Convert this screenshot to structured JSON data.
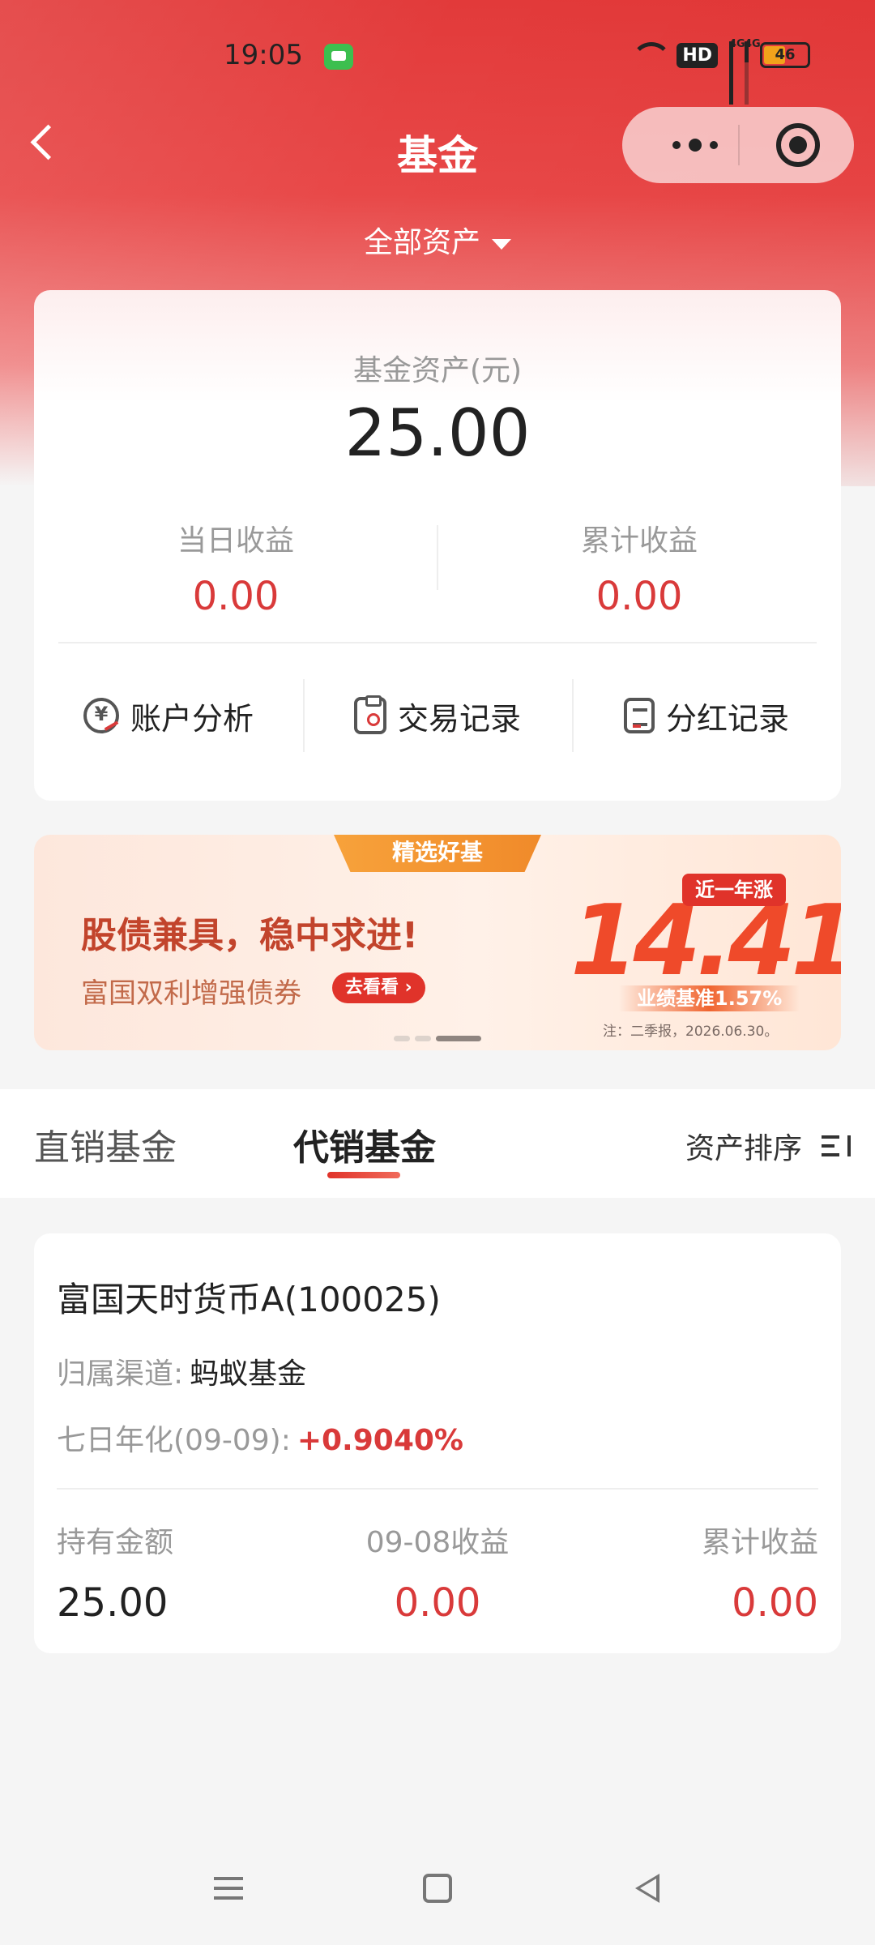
{
  "status_bar": {
    "time": "19:05",
    "hd_label": "HD",
    "net1": "4G",
    "net2": "4G",
    "battery": "46"
  },
  "nav": {
    "title": "基金",
    "asset_filter": "全部资产"
  },
  "asset_card": {
    "label": "基金资产(元)",
    "total": "25.00",
    "daily_label": "当日收益",
    "daily_value": "0.00",
    "cumulative_label": "累计收益",
    "cumulative_value": "0.00",
    "actions": [
      {
        "label": "账户分析",
        "icon": "account-analysis-icon"
      },
      {
        "label": "交易记录",
        "icon": "transaction-record-icon"
      },
      {
        "label": "分红记录",
        "icon": "dividend-record-icon"
      }
    ]
  },
  "banner": {
    "tag": "精选好基",
    "title": "股债兼具，稳中求进!",
    "fund": "富国双利增强债券",
    "cta": "去看看",
    "rate_main": "14.41",
    "rate_unit": "%",
    "period": "近一年涨",
    "benchmark": "业绩基准1.57%",
    "note": "注：二季报，2026.06.30。",
    "carousel_active_index": 3
  },
  "tabs": {
    "items": [
      "直销基金",
      "代销基金"
    ],
    "active": "代销基金",
    "sort_label": "资产排序"
  },
  "holding": {
    "name": "富国天时货币A(100025)",
    "channel_label": "归属渠道:",
    "channel_value": "蚂蚁基金",
    "yield_label": "七日年化(09-09):",
    "yield_value": "+0.9040%",
    "amount_label": "持有金额",
    "amount_value": "25.00",
    "daily_label": "09-08收益",
    "daily_value": "0.00",
    "cum_label": "累计收益",
    "cum_value": "0.00"
  },
  "colors": {
    "brand_red": "#e23a3a",
    "profit_red": "#d93a3a"
  }
}
